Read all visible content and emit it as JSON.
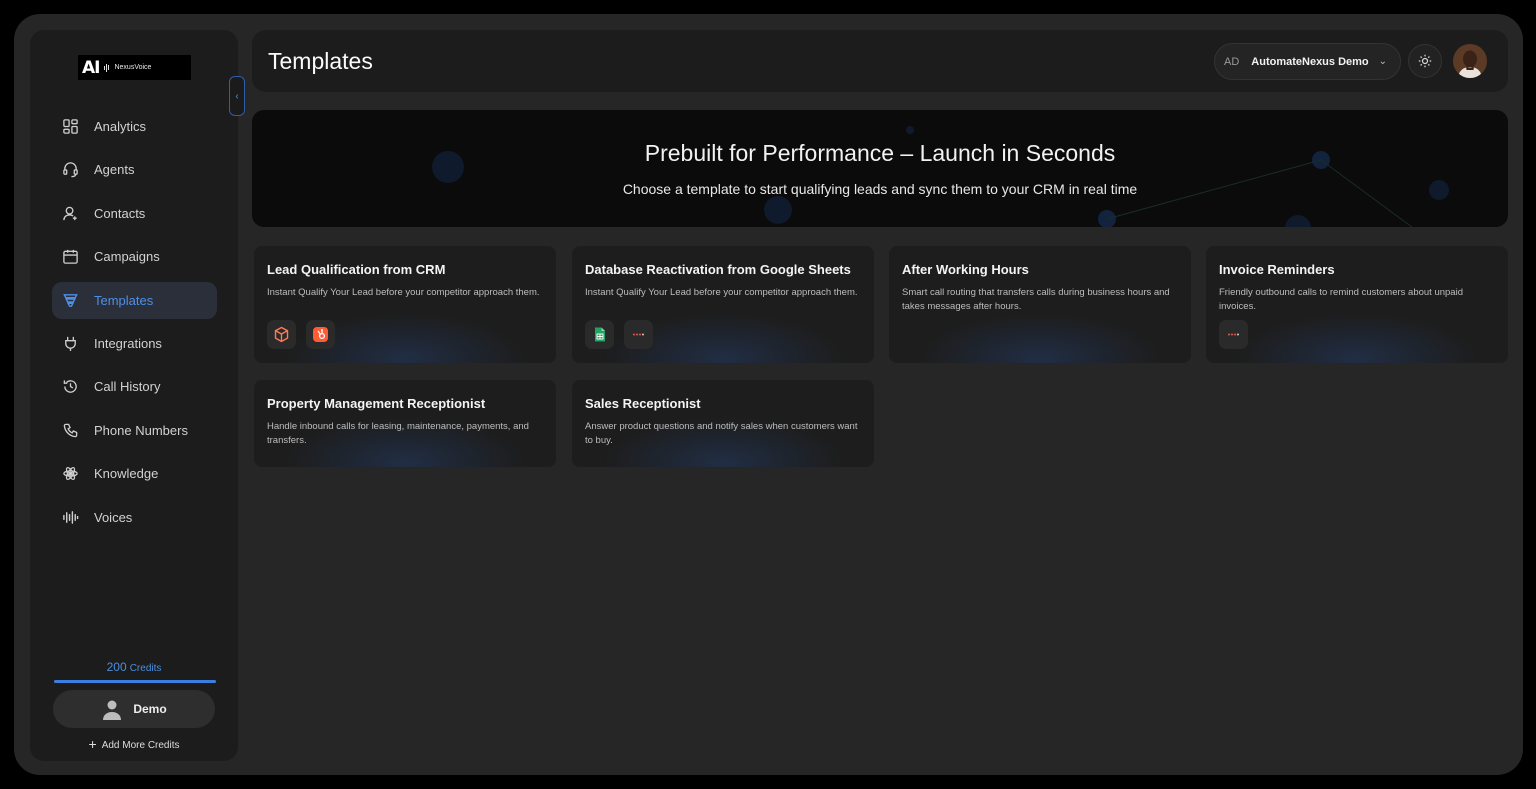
{
  "brand": {
    "mark": "AI",
    "name": "NexusVoice"
  },
  "sidebar": {
    "items": [
      {
        "label": "Analytics",
        "icon": "analytics-icon",
        "active": false
      },
      {
        "label": "Agents",
        "icon": "headset-icon",
        "active": false
      },
      {
        "label": "Contacts",
        "icon": "user-icon",
        "active": false
      },
      {
        "label": "Campaigns",
        "icon": "calendar-icon",
        "active": false
      },
      {
        "label": "Templates",
        "icon": "funnel-icon",
        "active": true
      },
      {
        "label": "Integrations",
        "icon": "plug-icon",
        "active": false
      },
      {
        "label": "Call History",
        "icon": "history-icon",
        "active": false
      },
      {
        "label": "Phone Numbers",
        "icon": "phone-icon",
        "active": false
      },
      {
        "label": "Knowledge",
        "icon": "atom-icon",
        "active": false
      },
      {
        "label": "Voices",
        "icon": "waveform-icon",
        "active": false
      }
    ],
    "credits": {
      "amount": "200",
      "unit": "Credits",
      "progress": 1.0
    },
    "user": {
      "name": "Demo"
    },
    "add_credits_label": "Add More Credits"
  },
  "header": {
    "title": "Templates",
    "account": {
      "initials": "AD",
      "name": "AutomateNexus Demo"
    }
  },
  "hero": {
    "title": "Prebuilt for Performance – Launch in Seconds",
    "subtitle": "Choose a template to start qualifying leads and sync them to your CRM in real time"
  },
  "templates": [
    {
      "title": "Lead Qualification from CRM",
      "description": "Instant Qualify Your Lead before your competitor approach them.",
      "integrations": [
        "box-icon",
        "hubspot-icon"
      ]
    },
    {
      "title": "Database Reactivation from Google Sheets",
      "description": "Instant Qualify Your Lead before your competitor approach them.",
      "integrations": [
        "google-sheets-icon",
        "dots-connector-icon"
      ]
    },
    {
      "title": "After Working Hours",
      "description": "Smart call routing that transfers calls during business hours and takes messages after hours.",
      "integrations": []
    },
    {
      "title": "Invoice Reminders",
      "description": "Friendly outbound calls to remind customers about unpaid invoices.",
      "integrations": [
        "dots-connector-icon"
      ]
    },
    {
      "title": "Property Management Receptionist",
      "description": "Handle inbound calls for leasing, maintenance, payments, and transfers.",
      "integrations": []
    },
    {
      "title": "Sales Receptionist",
      "description": "Answer product questions and notify sales when customers want to buy.",
      "integrations": []
    }
  ],
  "colors": {
    "accent": "#4d8fe6",
    "background": "#262626",
    "panel": "#1c1c1c",
    "hubspot": "#ff7a59",
    "sheets": "#1fa463"
  }
}
